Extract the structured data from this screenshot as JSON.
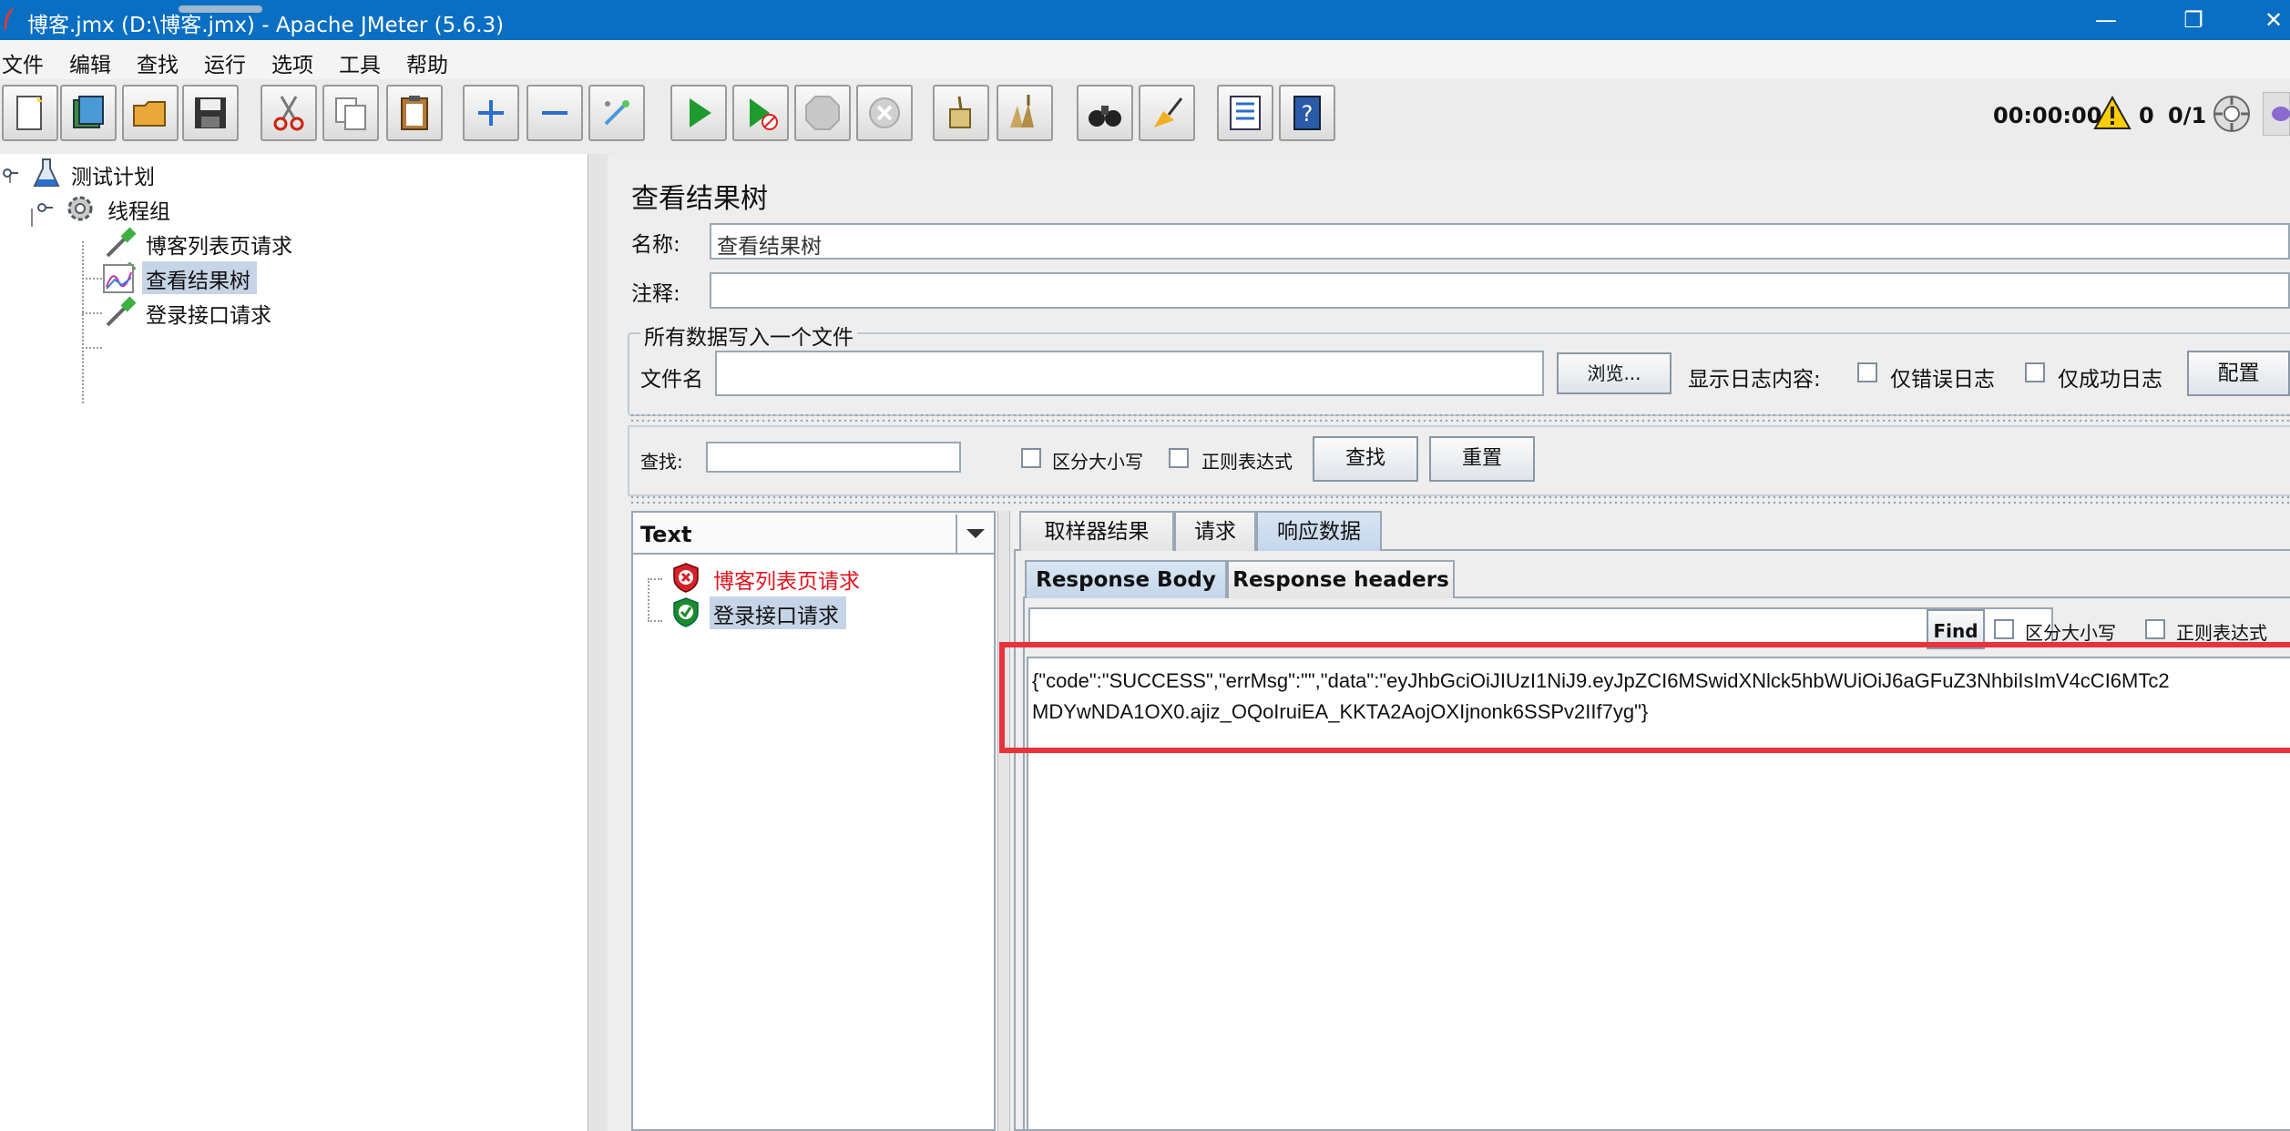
{
  "window": {
    "title": "博客.jmx (D:\\博客.jmx) - Apache JMeter (5.6.3)",
    "minimize": "—",
    "maximize": "❐",
    "close": "✕"
  },
  "menu": [
    "文件",
    "编辑",
    "查找",
    "运行",
    "选项",
    "工具",
    "帮助"
  ],
  "toolbar": {
    "timer": "00:00:00",
    "warnings": "0",
    "threads": "0/1"
  },
  "tree": {
    "root": "测试计划",
    "thread_group": "线程组",
    "children": [
      "博客列表页请求",
      "查看结果树",
      "登录接口请求"
    ]
  },
  "panel": {
    "title": "查看结果树",
    "name_label": "名称:",
    "name_value": "查看结果树",
    "comment_label": "注释:",
    "comment_value": "",
    "file_section": "所有数据写入一个文件",
    "file_label": "文件名",
    "browse": "浏览...",
    "log_label": "显示日志内容:",
    "errors_only": "仅错误日志",
    "success_only": "仅成功日志",
    "configure": "配置"
  },
  "search": {
    "label": "查找:",
    "case": "区分大小写",
    "regex": "正则表达式",
    "find_btn": "查找",
    "reset_btn": "重置"
  },
  "results": {
    "renderer": "Text",
    "samples": [
      {
        "label": "博客列表页请求",
        "status": "error",
        "color": "#e0141e"
      },
      {
        "label": "登录接口请求",
        "status": "success",
        "color": "#1a8a2a"
      }
    ]
  },
  "tabs": {
    "main": [
      "取样器结果",
      "请求",
      "响应数据"
    ],
    "sub": [
      "Response Body",
      "Response headers"
    ]
  },
  "body_search": {
    "find": "Find",
    "case": "区分大小写",
    "regex": "正则表达式"
  },
  "response": {
    "line1": "{\"code\":\"SUCCESS\",\"errMsg\":\"\",\"data\":\"eyJhbGciOiJIUzI1NiJ9.eyJpZCI6MSwidXNlck5hbWUiOiJ6aGFuZ3NhbiIsImV4cCI6MTc2",
    "line2": "MDYwNDA1OX0.ajiz_OQoIruiEA_KKTA2AojOXIjnonk6SSPv2IIf7yg\"}"
  },
  "colors": {
    "titlebar": "#0a6fc2",
    "highlight": "#e8323c"
  }
}
